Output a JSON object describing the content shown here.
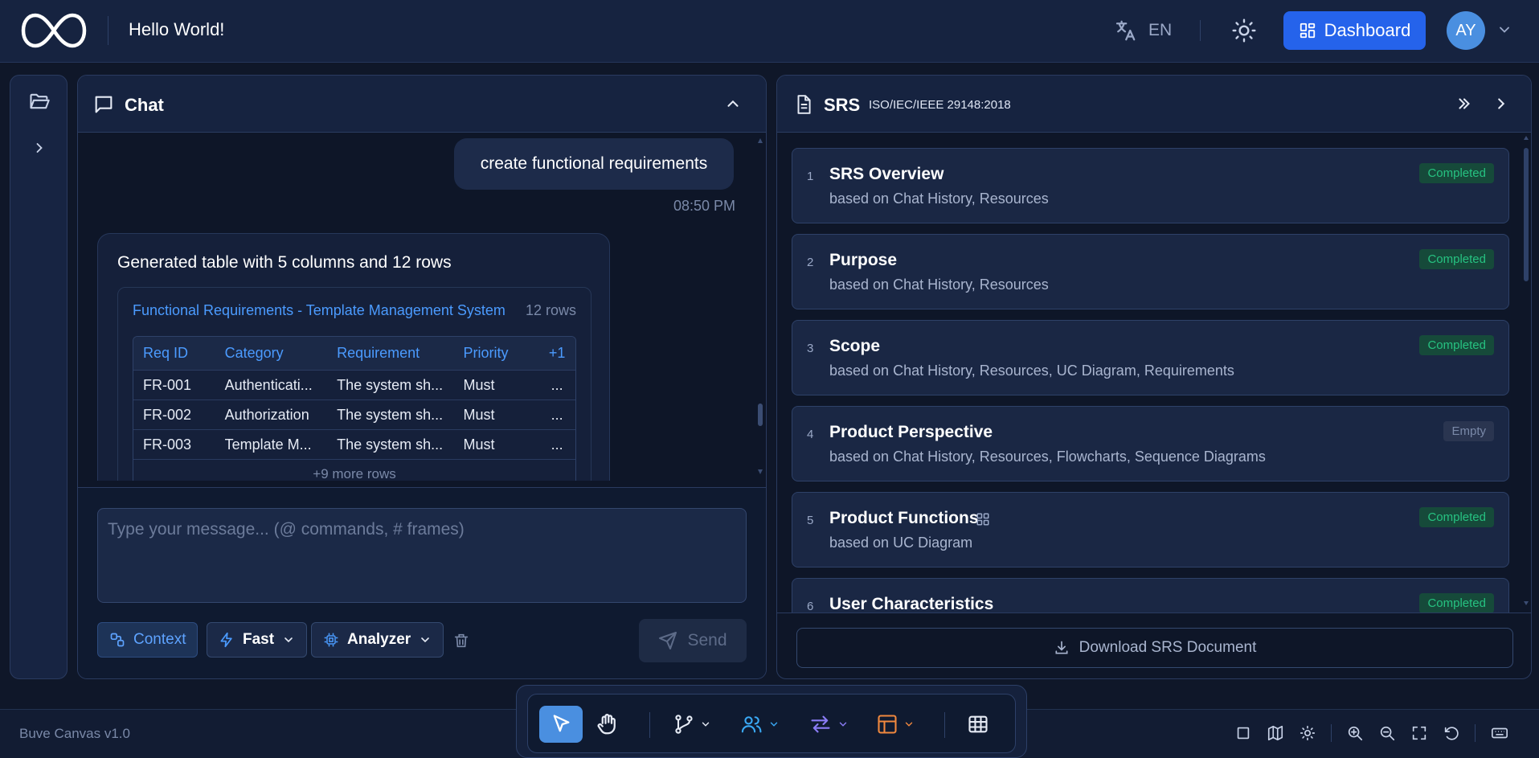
{
  "header": {
    "greeting": "Hello World!",
    "language": "EN",
    "dashboard_label": "Dashboard",
    "avatar_initials": "AY"
  },
  "chat": {
    "title": "Chat",
    "user_message": "create functional requirements",
    "user_message_time": "08:50 PM",
    "ai_message": "Generated table with 5 columns and 12 rows",
    "table": {
      "title": "Functional Requirements - Template Management System",
      "row_count": "12 rows",
      "columns": [
        "Req ID",
        "Category",
        "Requirement",
        "Priority",
        "+1"
      ],
      "rows": [
        [
          "FR-001",
          "Authenticati...",
          "The system sh...",
          "Must",
          "..."
        ],
        [
          "FR-002",
          "Authorization",
          "The system sh...",
          "Must",
          "..."
        ],
        [
          "FR-003",
          "Template M...",
          "The system sh...",
          "Must",
          "..."
        ]
      ],
      "more_rows": "+9 more rows"
    },
    "input_placeholder": "Type your message... (@ commands, # frames)",
    "context_label": "Context",
    "mode_label": "Fast",
    "agent_label": "Analyzer",
    "send_label": "Send"
  },
  "srs": {
    "title": "SRS",
    "standard": "ISO/IEC/IEEE 29148:2018",
    "sections": [
      {
        "num": "1",
        "title": "SRS Overview",
        "sub": "based on Chat History, Resources",
        "status": "Completed"
      },
      {
        "num": "2",
        "title": "Purpose",
        "sub": "based on Chat History, Resources",
        "status": "Completed"
      },
      {
        "num": "3",
        "title": "Scope",
        "sub": "based on Chat History, Resources, UC Diagram, Requirements",
        "status": "Completed"
      },
      {
        "num": "4",
        "title": "Product Perspective",
        "sub": "based on Chat History, Resources, Flowcharts, Sequence Diagrams",
        "status": "Empty"
      },
      {
        "num": "5",
        "title": "Product Functions",
        "sub": "based on UC Diagram",
        "status": "Completed"
      },
      {
        "num": "6",
        "title": "User Characteristics",
        "sub": "",
        "status": "Completed"
      }
    ],
    "download_label": "Download SRS Document"
  },
  "footer": {
    "version": "Buve Canvas v1.0"
  },
  "colors": {
    "accent": "#2563eb",
    "link": "#4b9bff",
    "completed": "#26c281",
    "background": "#0f1729"
  }
}
